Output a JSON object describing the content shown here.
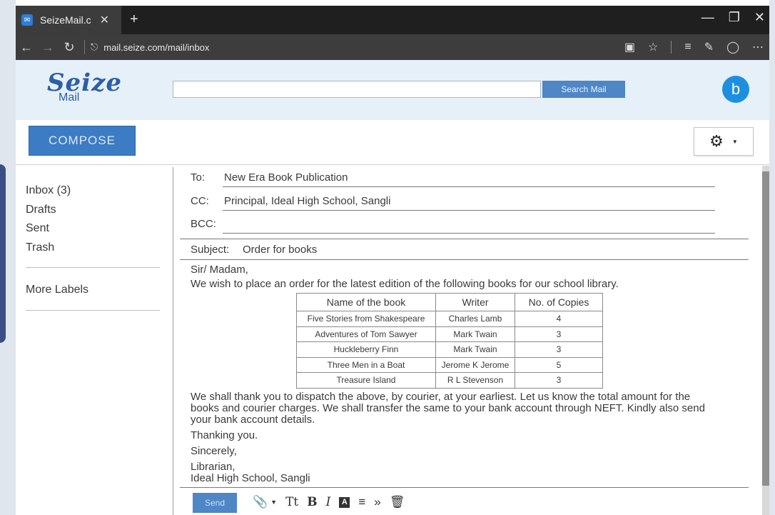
{
  "browser": {
    "tab_title": "SeizeMail.c",
    "new_tab_label": "+",
    "url": "mail.seize.com/mail/inbox"
  },
  "app": {
    "logo_word": "Seize",
    "logo_sub": "Mail",
    "search_placeholder": "",
    "search_button": "Search Mail",
    "avatar_letter": "b",
    "compose_label": "COMPOSE"
  },
  "sidebar": {
    "items": [
      {
        "label": "Inbox (3)"
      },
      {
        "label": "Drafts"
      },
      {
        "label": "Sent"
      },
      {
        "label": "Trash"
      }
    ],
    "more_labels": "More Labels"
  },
  "compose": {
    "to_label": "To:",
    "to_value": "New Era Book Publication",
    "cc_label": "CC:",
    "cc_value": "Principal, Ideal High School, Sangli",
    "bcc_label": "BCC:",
    "bcc_value": "",
    "subject_label": "Subject:",
    "subject_value": "Order for books",
    "body": {
      "greeting": "Sir/ Madam,",
      "intro": "We wish to place an order for the latest edition of the following books for our school library.",
      "table": {
        "headers": [
          "Name of the book",
          "Writer",
          "No. of Copies"
        ],
        "rows": [
          [
            "Five Stories from Shakespeare",
            "Charles Lamb",
            "4"
          ],
          [
            "Adventures of Tom Sawyer",
            "Mark Twain",
            "3"
          ],
          [
            "Huckleberry Finn",
            "Mark Twain",
            "3"
          ],
          [
            "Three Men in a Boat",
            "Jerome K Jerome",
            "5"
          ],
          [
            "Treasure Island",
            "R L Stevenson",
            "3"
          ]
        ]
      },
      "paragraph_line1": "We shall thank you to dispatch the above, by courier, at your earliest. Let us know the total amount for the",
      "paragraph_line2": "books and courier charges. We shall transfer the same to your bank account through NEFT. Kindly also send",
      "paragraph_line3": "your bank account details.",
      "thanks": "Thanking you.",
      "closing": "Sincerely,",
      "signature_title": "Librarian,",
      "signature_org": "Ideal High School, Sangli"
    },
    "send_label": "Send",
    "format_text_label": "Tt",
    "bold_label": "B",
    "italic_label": "I",
    "color_label": "A"
  },
  "colors": {
    "accent": "#3c7cc4",
    "header_bg": "#e6f0f9",
    "avatar": "#1e8fe0",
    "titlebar": "#1f1f1f"
  }
}
